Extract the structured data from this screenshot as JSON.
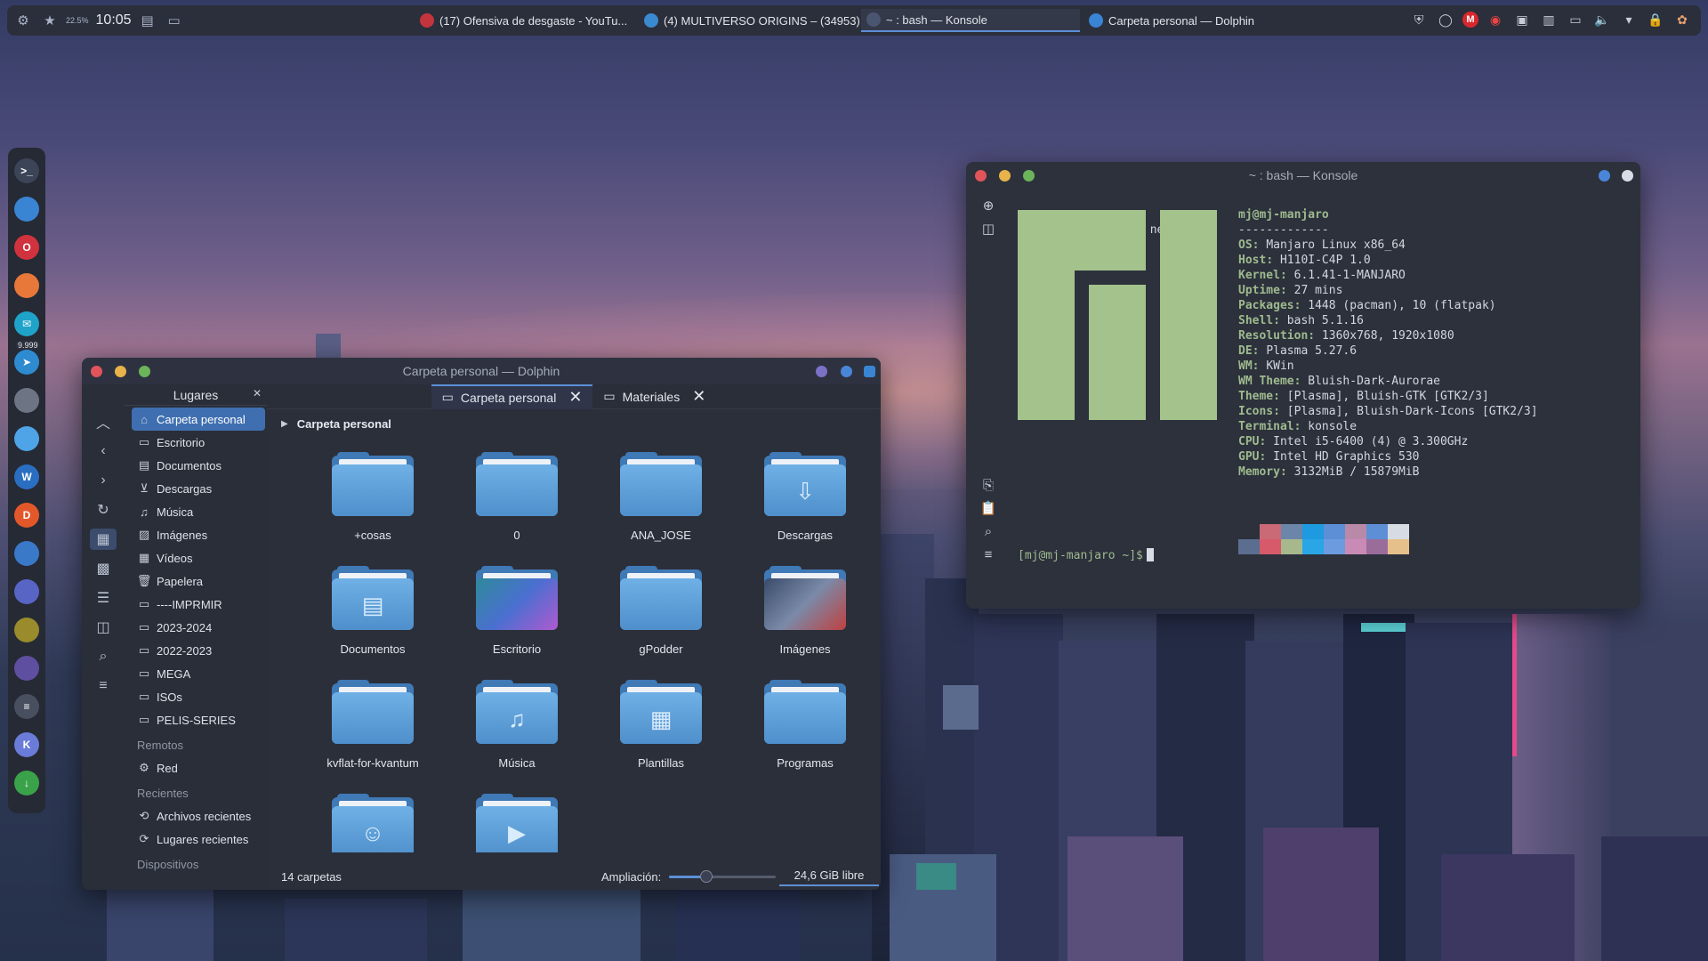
{
  "topbar": {
    "cpu": "22.5%",
    "clock": "10:05",
    "badge": "9.999",
    "tasks": [
      {
        "label": "(17) Ofensiva de desgaste - YouTu...",
        "icon": "opera-icon",
        "color": "#c4343d"
      },
      {
        "label": "(4) MULTIVERSO ORIGINS – (34953)",
        "icon": "telegram-icon",
        "color": "#3a8ad0"
      },
      {
        "label": "~ : bash — Konsole",
        "icon": "konsole-icon",
        "color": "#2b3a52"
      },
      {
        "label": "Carpeta personal — Dolphin",
        "icon": "dolphin-icon",
        "color": "#3a84d4"
      }
    ],
    "tray_icons": [
      "shield-icon",
      "circle-icon",
      "mega-icon",
      "chrome-icon",
      "clipboard-icon",
      "panel-icon",
      "display-icon",
      "volume-icon",
      "dropdown-icon",
      "lock-icon",
      "settings-icon"
    ]
  },
  "dock": {
    "badge": "9.999",
    "items": [
      {
        "name": "konsole-dock-icon",
        "color": "#3c4458",
        "glyph": ">_"
      },
      {
        "name": "dolphin-dock-icon",
        "color": "#3a84d4",
        "glyph": ""
      },
      {
        "name": "opera-dock-icon",
        "color": "#d0323e",
        "glyph": "O"
      },
      {
        "name": "firefox-dock-icon",
        "color": "#e8773a",
        "glyph": ""
      },
      {
        "name": "mail-dock-icon",
        "color": "#1fa3c9",
        "glyph": "✉"
      },
      {
        "name": "telegram-dock-icon",
        "color": "#2e8bd0",
        "glyph": "➤"
      },
      {
        "name": "gimp-dock-icon",
        "color": "#6d7585",
        "glyph": ""
      },
      {
        "name": "vpn-dock-icon",
        "color": "#4ea4e6",
        "glyph": ""
      },
      {
        "name": "writer-dock-icon",
        "color": "#2a6ec2",
        "glyph": "W"
      },
      {
        "name": "deezer-dock-icon",
        "color": "#e3582a",
        "glyph": "D"
      },
      {
        "name": "browser-dock-icon",
        "color": "#3a78c8",
        "glyph": ""
      },
      {
        "name": "discord-dock-icon",
        "color": "#5865c4",
        "glyph": ""
      },
      {
        "name": "game-dock-icon",
        "color": "#9a8b2c",
        "glyph": ""
      },
      {
        "name": "app-dock-icon",
        "color": "#5f4fa0",
        "glyph": ""
      },
      {
        "name": "mixer-dock-icon",
        "color": "#48505f",
        "glyph": "≡"
      },
      {
        "name": "kodi-dock-icon",
        "color": "#6b7bd8",
        "glyph": "K"
      },
      {
        "name": "download-dock-icon",
        "color": "#3aa34a",
        "glyph": "↓"
      }
    ]
  },
  "dolphin": {
    "title": "Carpeta personal — Dolphin",
    "places_header": "Lugares",
    "places": [
      {
        "label": "Carpeta personal",
        "icon": "home-icon"
      },
      {
        "label": "Escritorio",
        "icon": "desktop-icon"
      },
      {
        "label": "Documentos",
        "icon": "document-icon"
      },
      {
        "label": "Descargas",
        "icon": "download-icon"
      },
      {
        "label": "Música",
        "icon": "music-icon"
      },
      {
        "label": "Imágenes",
        "icon": "image-icon"
      },
      {
        "label": "Vídeos",
        "icon": "video-icon"
      },
      {
        "label": "Papelera",
        "icon": "trash-icon"
      },
      {
        "label": "----IMPRMIR",
        "icon": "folder-icon"
      },
      {
        "label": "2023-2024",
        "icon": "folder-icon"
      },
      {
        "label": "2022-2023",
        "icon": "folder-icon"
      },
      {
        "label": "MEGA",
        "icon": "folder-icon"
      },
      {
        "label": "ISOs",
        "icon": "folder-icon"
      },
      {
        "label": "PELIS-SERIES",
        "icon": "folder-icon"
      }
    ],
    "remote_header": "Remotos",
    "remote": [
      {
        "label": "Red",
        "icon": "network-icon"
      }
    ],
    "recent_header": "Recientes",
    "recent": [
      {
        "label": "Archivos recientes",
        "icon": "recent-files-icon"
      },
      {
        "label": "Lugares recientes",
        "icon": "recent-places-icon"
      }
    ],
    "devices_header": "Dispositivos",
    "tabs": [
      {
        "label": "Carpeta personal",
        "active": true
      },
      {
        "label": "Materiales",
        "active": false
      }
    ],
    "breadcrumb": "Carpeta personal",
    "files": [
      {
        "label": "+cosas",
        "glyph": ""
      },
      {
        "label": "0",
        "glyph": ""
      },
      {
        "label": "ANA_JOSE",
        "glyph": ""
      },
      {
        "label": "Descargas",
        "glyph": "⇩"
      },
      {
        "label": "Documentos",
        "glyph": "▤"
      },
      {
        "label": "Escritorio",
        "glyph": ""
      },
      {
        "label": "gPodder",
        "glyph": ""
      },
      {
        "label": "Imágenes",
        "glyph": ""
      },
      {
        "label": "kvflat-for-kvantum",
        "glyph": ""
      },
      {
        "label": "Música",
        "glyph": "♫"
      },
      {
        "label": "Plantillas",
        "glyph": "▦"
      },
      {
        "label": "Programas",
        "glyph": ""
      },
      {
        "label": "",
        "glyph": "☺"
      },
      {
        "label": "",
        "glyph": "▶"
      }
    ],
    "status": {
      "count": "14 carpetas",
      "zoom_label": "Ampliación:",
      "zoom_level": 0.35,
      "free": "24,6 GiB libre",
      "free_fraction": 0.25
    }
  },
  "konsole": {
    "title": "~ : bash — Konsole",
    "prompt": "[mj@mj-manjaro ~]$",
    "command": "neofetch",
    "user_host": "mj@mj-manjaro",
    "separator": "-------------",
    "info": [
      {
        "key": "OS",
        "value": "Manjaro Linux x86_64"
      },
      {
        "key": "Host",
        "value": "H110I-C4P 1.0"
      },
      {
        "key": "Kernel",
        "value": "6.1.41-1-MANJARO"
      },
      {
        "key": "Uptime",
        "value": "27 mins"
      },
      {
        "key": "Packages",
        "value": "1448 (pacman), 10 (flatpak)"
      },
      {
        "key": "Shell",
        "value": "bash 5.1.16"
      },
      {
        "key": "Resolution",
        "value": "1360x768, 1920x1080"
      },
      {
        "key": "DE",
        "value": "Plasma 5.27.6"
      },
      {
        "key": "WM",
        "value": "KWin"
      },
      {
        "key": "WM Theme",
        "value": "Bluish-Dark-Aurorae"
      },
      {
        "key": "Theme",
        "value": "[Plasma], Bluish-GTK [GTK2/3]"
      },
      {
        "key": "Icons",
        "value": "[Plasma], Bluish-Dark-Icons [GTK2/3]"
      },
      {
        "key": "Terminal",
        "value": "konsole"
      },
      {
        "key": "CPU",
        "value": "Intel i5-6400 (4) @ 3.300GHz"
      },
      {
        "key": "GPU",
        "value": "Intel HD Graphics 530"
      },
      {
        "key": "Memory",
        "value": "3132MiB / 15879MiB"
      }
    ],
    "colors_top": [
      "#2c313c",
      "#c96a76",
      "#6b86a8",
      "#1e9ae0",
      "#5d8fd6",
      "#b98aa8",
      "#5d8fd6",
      "#d6dbe4"
    ],
    "colors_bottom": [
      "#5b6e90",
      "#d65a6a",
      "#a7b88c",
      "#2aa5e6",
      "#6c9be0",
      "#c98ab6",
      "#9a6c9a",
      "#e6c08a"
    ],
    "logo_color": "#a4c38c"
  },
  "colors": {
    "accent": "#5d8fd6",
    "panel": "#2b2f3b",
    "window": "#2a2e39"
  }
}
